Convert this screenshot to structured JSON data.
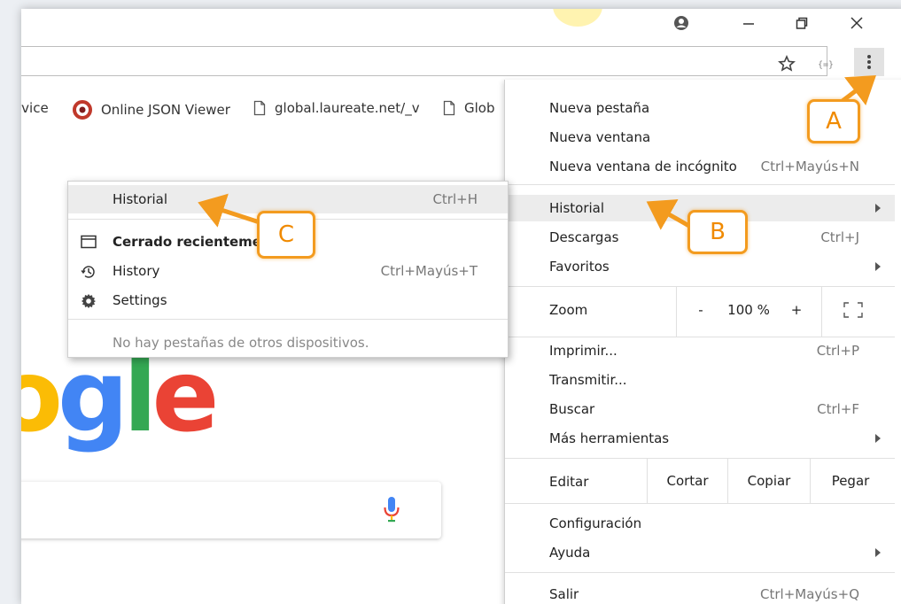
{
  "bookmarks": [
    {
      "label": "rvice"
    },
    {
      "label": "Online JSON Viewer"
    },
    {
      "label": "global.laureate.net/_v"
    },
    {
      "label": "Glob"
    }
  ],
  "menu": {
    "new_tab": "Nueva pestaña",
    "new_window": "Nueva ventana",
    "incognito": {
      "label": "Nueva ventana de incógnito",
      "shortcut": "Ctrl+Mayús+N"
    },
    "history": "Historial",
    "downloads": {
      "label": "Descargas",
      "shortcut": "Ctrl+J"
    },
    "bookmarks": "Favoritos",
    "zoom": {
      "label": "Zoom",
      "minus": "-",
      "value": "100 %",
      "plus": "+"
    },
    "print": {
      "label": "Imprimir...",
      "shortcut": "Ctrl+P"
    },
    "cast": "Transmitir...",
    "find": {
      "label": "Buscar",
      "shortcut": "Ctrl+F"
    },
    "more_tools": "Más herramientas",
    "edit": {
      "label": "Editar",
      "cut": "Cortar",
      "copy": "Copiar",
      "paste": "Pegar"
    },
    "settings": "Configuración",
    "help": "Ayuda",
    "exit": {
      "label": "Salir",
      "shortcut": "Ctrl+Mayús+Q"
    }
  },
  "submenu": {
    "history": {
      "label": "Historial",
      "shortcut": "Ctrl+H"
    },
    "recently_closed": "Cerrado recientemer",
    "history_tab": {
      "label": "History",
      "shortcut": "Ctrl+Mayús+T"
    },
    "settings_tab": "Settings",
    "no_tabs": "No hay pestañas de otros dispositivos."
  },
  "google_logo": {
    "letters": [
      "o",
      "g",
      "l",
      "e"
    ],
    "colors": [
      "#fbbc05",
      "#4285f4",
      "#34a853",
      "#ea4335"
    ]
  },
  "callouts": {
    "a": "A",
    "b": "B",
    "c": "C"
  },
  "colors": {
    "accent": "#f39b1f",
    "menu_highlight": "#ececec"
  }
}
